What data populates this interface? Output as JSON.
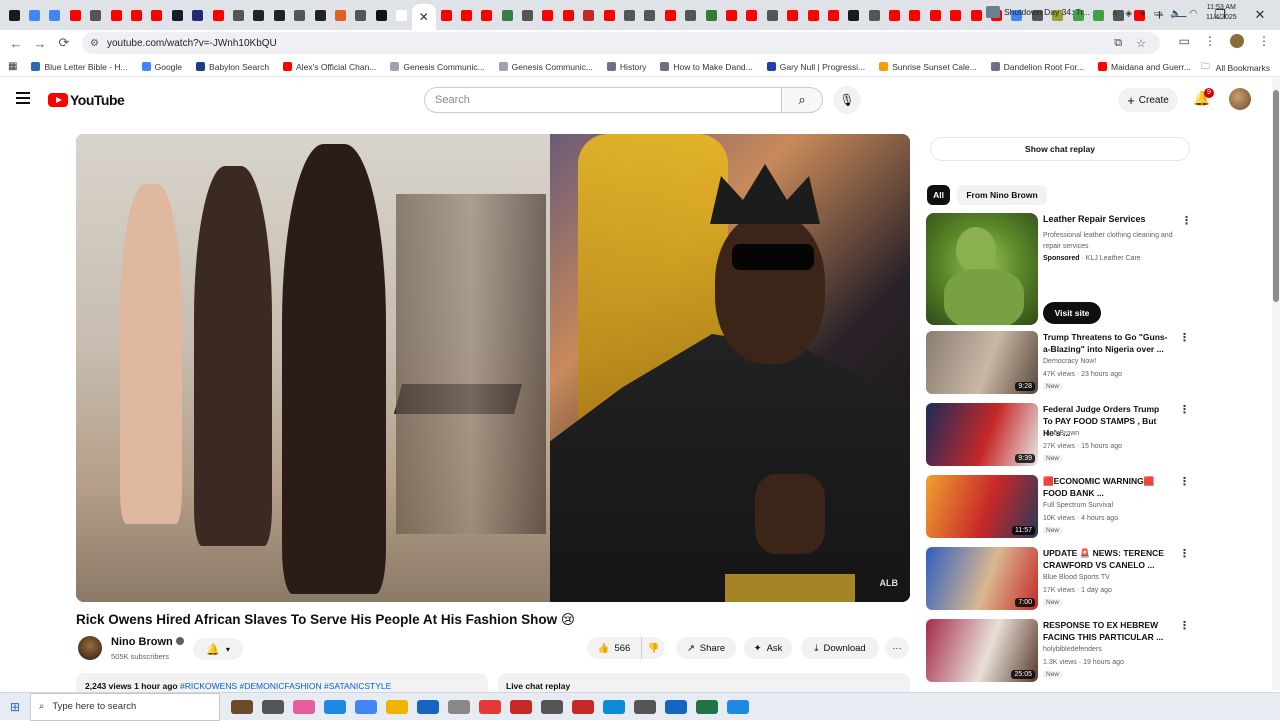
{
  "browser": {
    "tab_favicon_colors": [
      "#1a1a1a",
      "#4285f4",
      "#4285f4",
      "#ff0000",
      "#555",
      "#ff0000",
      "#ff0000",
      "#ff0000",
      "#1a1a2e",
      "#1f2b6e",
      "#ff0000",
      "#555",
      "#222",
      "#222",
      "#555",
      "#222",
      "#e06020",
      "#555",
      "#111",
      "#ffffff",
      "#ff0000",
      "#ff0000",
      "#ff0000",
      "#3a7d44",
      "#555",
      "#ff0000",
      "#ff0000",
      "#c62828",
      "#ff0000",
      "#555",
      "#555",
      "#ff0000",
      "#555",
      "#2e7d32",
      "#ff0000",
      "#ff0000",
      "#555",
      "#ff0000",
      "#ff0000",
      "#ff0000",
      "#1a1a1a",
      "#555",
      "#ff0000",
      "#ff0000",
      "#ff0000",
      "#ff0000",
      "#ff0000",
      "#ff0000",
      "#4285f4",
      "#555",
      "#9aa033",
      "#43a047",
      "#43a047",
      "#555",
      "#ff0000"
    ],
    "active_tab_icon": "close-icon",
    "url": "youtube.com/watch?v=-JWnh10KbQU",
    "window_controls": [
      "minimize-icon",
      "maximize-icon",
      "close-icon"
    ],
    "bookmarks": [
      {
        "label": "Blue Letter Bible - H...",
        "color": "#2b6cb0"
      },
      {
        "label": "Google",
        "color": "#4285f4"
      },
      {
        "label": "Babylon Search",
        "color": "#1e3a8a"
      },
      {
        "label": "Alex's Official Chan...",
        "color": "#ff0000"
      },
      {
        "label": "Genesis Communic...",
        "color": "#9ca3af"
      },
      {
        "label": "Genesis Communic...",
        "color": "#9ca3af"
      },
      {
        "label": "History",
        "color": "#6b7280"
      },
      {
        "label": "How to Make Dand...",
        "color": "#6b7280"
      },
      {
        "label": "Gary Null | Progressi...",
        "color": "#1e40af"
      },
      {
        "label": "Sunrise Sunset Cale...",
        "color": "#f59e0b"
      },
      {
        "label": "Dandelion Root For...",
        "color": "#6b7280"
      },
      {
        "label": "Maidana and Guerr...",
        "color": "#ff0000"
      }
    ],
    "all_bookmarks": "All Bookmarks"
  },
  "youtube": {
    "logo_text": "YouTube",
    "search_placeholder": "Search",
    "create_label": "Create",
    "notification_count": "9",
    "video": {
      "title": "Rick Owens Hired African Slaves To Serve His People At His Fashion Show 😢",
      "watermark": "ALB",
      "channel_name": "Nino Brown",
      "subscribers": "505K subscribers",
      "likes": "566",
      "share_label": "Share",
      "ask_label": "Ask",
      "download_label": "Download",
      "views_date": "2,243 views  1 hour ago",
      "tags": "#RICKOWENS #DEMONICFASHION #SATANICSTYLE",
      "live_chat_replay": "Live chat replay"
    },
    "sidebar": {
      "show_chat_replay": "Show chat replay",
      "chips": [
        "All",
        "From Nino Brown"
      ],
      "ad": {
        "title": "Leather Repair Services",
        "description": "Professional leather clothing cleaning and repair services",
        "sponsored": "Sponsored",
        "advertiser": "KLJ Leather Care",
        "cta": "Visit site"
      },
      "recommendations": [
        {
          "title": "Trump Threatens to Go \"Guns-a-Blazing\" into Nigeria over ...",
          "channel": "Democracy Now!",
          "meta": "47K views · 23 hours ago",
          "badge": "New",
          "duration": "9:28",
          "colors": [
            "#8a7d72",
            "#c9b8a6",
            "#5a4a3c"
          ]
        },
        {
          "title": "Federal Judge Orders Trump To PAY FOOD STAMPS , But He's ...",
          "channel": "Nino Brown",
          "meta": "27K views · 15 hours ago",
          "badge": "New",
          "duration": "9:39",
          "colors": [
            "#1c2b5a",
            "#c62828",
            "#e8e8e8"
          ]
        },
        {
          "title": "🟥ECONOMIC WARNING🟥FOOD BANK ...",
          "channel": "Full Spectrum Survival",
          "meta": "10K views · 4 hours ago",
          "badge": "New",
          "duration": "11:57",
          "colors": [
            "#f0a030",
            "#c62828",
            "#2a3a5a"
          ]
        },
        {
          "title": "UPDATE 🚨 NEWS: TERENCE CRAWFORD VS CANELO ...",
          "channel": "Blue Blood Sports TV",
          "meta": "17K views · 1 day ago",
          "badge": "New",
          "duration": "7:00",
          "colors": [
            "#2f5fbf",
            "#d9b890",
            "#c62828"
          ]
        },
        {
          "title": "RESPONSE TO EX HEBREW FACING THIS PARTICULAR ...",
          "channel": "holybibledefenders",
          "meta": "1.3K views · 19 hours ago",
          "badge": "New",
          "duration": "25:05",
          "colors": [
            "#a52a4a",
            "#e8e0d8",
            "#5a3a2a"
          ]
        }
      ]
    }
  },
  "taskbar": {
    "search_placeholder": "Type here to search",
    "pinned_colors": [
      "#6a4a2a",
      "#555",
      "#e45d9c",
      "#1e88e5",
      "#4285f4",
      "#f0b400",
      "#1565c0",
      "#888",
      "#e53935",
      "#c62828",
      "#555",
      "#c62828",
      "#0b8ad8",
      "#555",
      "#1565c0",
      "#217346",
      "#1e88e5"
    ],
    "news": "Shutdown Day 34: Tr...",
    "time": "11:53 AM",
    "date": "11/4/2025"
  }
}
